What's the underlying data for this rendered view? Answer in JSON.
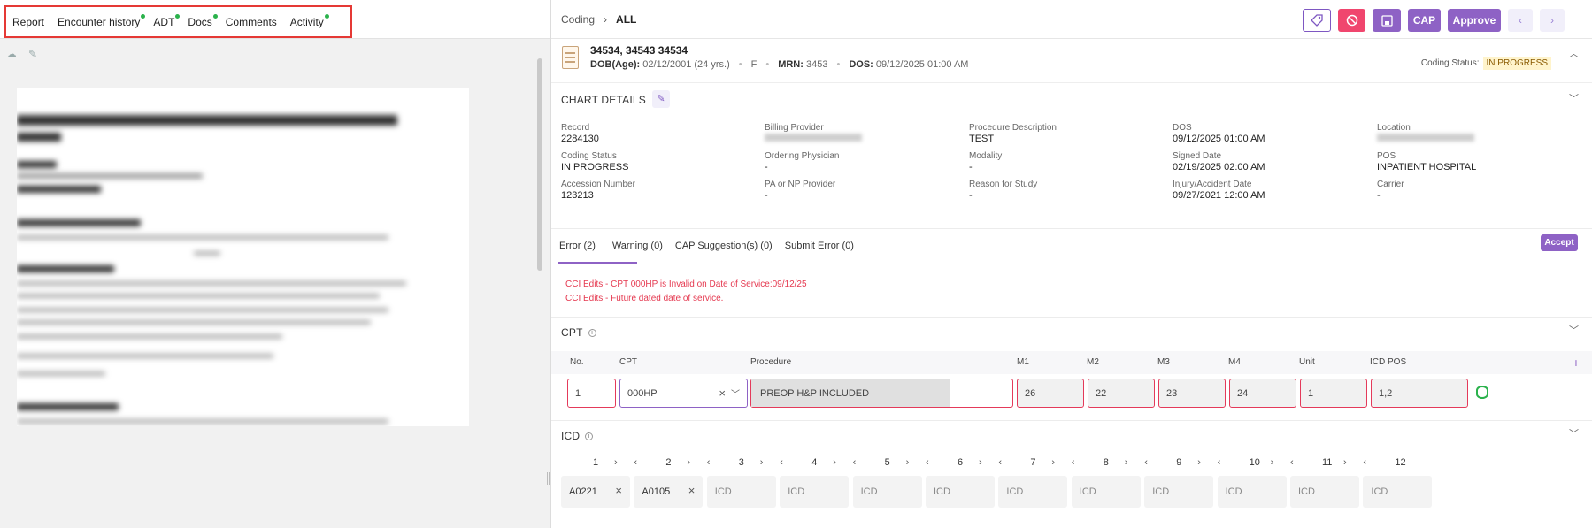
{
  "left_tabs": [
    {
      "label": "Report",
      "dot": false
    },
    {
      "label": "Encounter history",
      "dot": true
    },
    {
      "label": "ADT",
      "dot": true
    },
    {
      "label": "Docs",
      "dot": true
    },
    {
      "label": "Comments",
      "dot": false
    },
    {
      "label": "Activity",
      "dot": true
    }
  ],
  "left_tools": [
    "cloud-icon",
    "edit-doc-icon"
  ],
  "breadcrumb": {
    "parent": "Coding",
    "separator": "›",
    "current": "ALL"
  },
  "actions": {
    "tag_icon": "tag-icon",
    "block_icon": "block-icon",
    "save_icon": "save-icon",
    "cap": "CAP",
    "approve": "Approve",
    "prev": "‹",
    "next": "›"
  },
  "patient": {
    "name": "34534, 34543 34534",
    "dob_label": "DOB(Age):",
    "dob": "02/12/2001 (24 yrs.)",
    "sex": "F",
    "mrn_label": "MRN:",
    "mrn": "3453",
    "dos_label": "DOS:",
    "dos": "09/12/2025 01:00 AM",
    "coding_status_label": "Coding Status:",
    "coding_status": "IN PROGRESS"
  },
  "chart_details": {
    "title": "CHART DETAILS",
    "fields": [
      {
        "label": "Record",
        "value": "2284130"
      },
      {
        "label": "Billing Provider",
        "value": "",
        "blurred": true
      },
      {
        "label": "Procedure Description",
        "value": "TEST"
      },
      {
        "label": "DOS",
        "value": "09/12/2025 01:00 AM"
      },
      {
        "label": "Location",
        "value": "",
        "blurred": true
      },
      {
        "label": "Coding Status",
        "value": "IN PROGRESS"
      },
      {
        "label": "Ordering Physician",
        "value": "-"
      },
      {
        "label": "Modality",
        "value": "-"
      },
      {
        "label": "Signed Date",
        "value": "02/19/2025 02:00 AM"
      },
      {
        "label": "POS",
        "value": "INPATIENT HOSPITAL"
      },
      {
        "label": "Accession Number",
        "value": "123213"
      },
      {
        "label": "PA or NP Provider",
        "value": "-"
      },
      {
        "label": "Reason for Study",
        "value": "-"
      },
      {
        "label": "Injury/Accident Date",
        "value": "09/27/2021 12:00 AM"
      },
      {
        "label": "Carrier",
        "value": "-"
      }
    ]
  },
  "error_tabs": [
    "Error (2)",
    "Warning (0)",
    "CAP Suggestion(s) (0)",
    "Submit Error (0)"
  ],
  "accept": "Accept",
  "errors": [
    "CCI Edits - CPT 000HP is Invalid on Date of Service:09/12/25",
    "CCI Edits - Future dated date of service."
  ],
  "cpt": {
    "title": "CPT",
    "headers": [
      "No.",
      "CPT",
      "Procedure",
      "M1",
      "M2",
      "M3",
      "M4",
      "Unit",
      "ICD POS"
    ],
    "row": {
      "no": "1",
      "cpt": "000HP",
      "procedure": "PREOP H&P INCLUDED",
      "m1": "26",
      "m2": "22",
      "m3": "23",
      "m4": "24",
      "unit": "1",
      "icd_pos": "1,2"
    }
  },
  "icd": {
    "title": "ICD",
    "numbers": [
      "1",
      "2",
      "3",
      "4",
      "5",
      "6",
      "7",
      "8",
      "9",
      "10",
      "11",
      "12"
    ],
    "codes": [
      "A0221",
      "A0105",
      "",
      "",
      "",
      "",
      "",
      "",
      "",
      "",
      "",
      ""
    ],
    "placeholder": "ICD"
  }
}
